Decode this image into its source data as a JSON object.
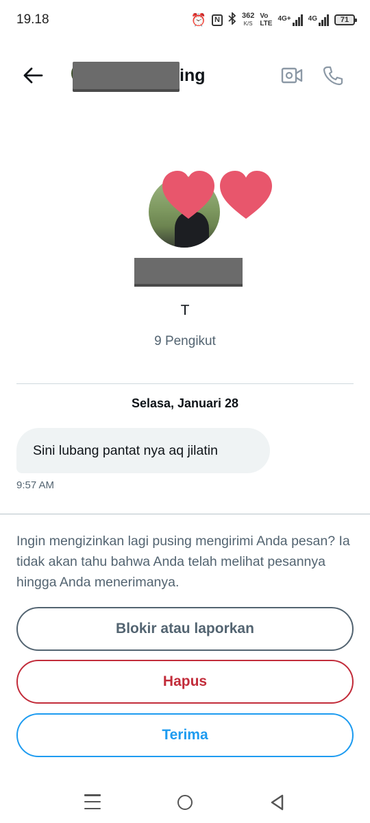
{
  "status_bar": {
    "time": "19.18",
    "speed_value": "362",
    "speed_unit": "K/S",
    "volte_top": "Vo",
    "volte_bottom": "LTE",
    "net1_label": "4G+",
    "net2_label": "4G",
    "battery": "71",
    "icons": [
      "alarm-icon",
      "nfc-icon",
      "bluetooth-icon",
      "signal-icon",
      "battery-icon"
    ]
  },
  "header": {
    "title_suffix": "ing",
    "icons": [
      "back-arrow-icon",
      "video-call-icon",
      "phone-call-icon"
    ]
  },
  "profile": {
    "handle": "T",
    "followers": "9 Pengikut"
  },
  "conversation": {
    "date": "Selasa, Januari 28",
    "messages": [
      {
        "text": "Sini lubang pantat nya aq jilatin",
        "time": "9:57 AM"
      }
    ]
  },
  "request": {
    "prompt": "Ingin mengizinkan lagi pusing mengirimi Anda pesan? Ia tidak akan tahu bahwa Anda telah melihat pesannya hingga Anda menerimanya.",
    "block_label": "Blokir atau laporkan",
    "delete_label": "Hapus",
    "accept_label": "Terima"
  },
  "colors": {
    "secondary_text": "#536471",
    "danger": "#c22c3a",
    "accent": "#1d9bf0",
    "bubble_bg": "#eff3f4"
  }
}
